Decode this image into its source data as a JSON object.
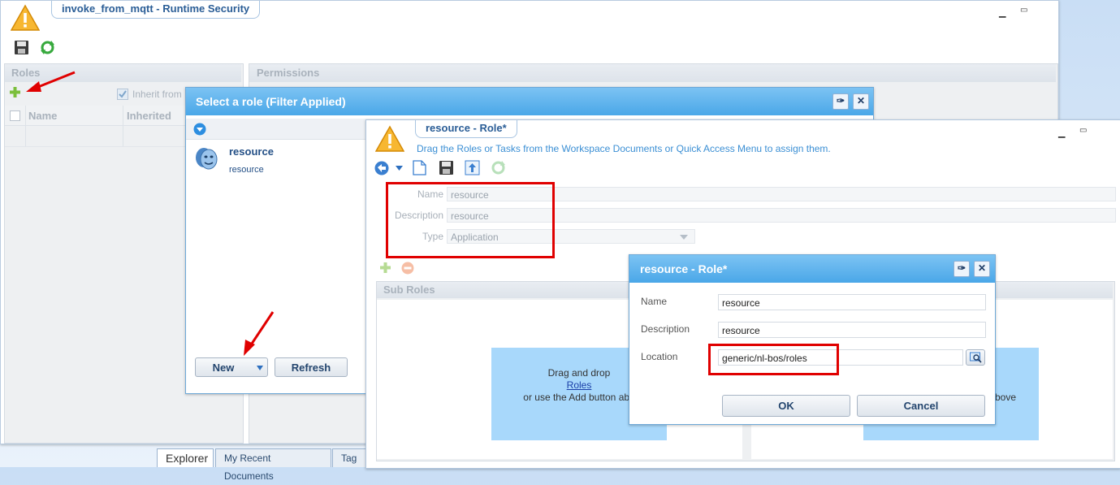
{
  "main_window": {
    "title": "invoke_from_mqtt - Runtime Security",
    "roles_panel": {
      "title": "Roles",
      "inherit_label": "Inherit from",
      "columns": [
        "Name",
        "Inherited"
      ]
    },
    "permissions_panel": {
      "title": "Permissions"
    }
  },
  "select_role_dialog": {
    "title": "Select a role (Filter Applied)",
    "item": {
      "name": "resource",
      "subtitle": "resource"
    },
    "new_label": "New",
    "refresh_label": "Refresh"
  },
  "role_editor": {
    "title": "resource - Role*",
    "instruction": "Drag the Roles or Tasks from the Workspace Documents or Quick Access Menu to assign them.",
    "name_label": "Name",
    "name_value": "resource",
    "description_label": "Description",
    "description_value": "resource",
    "type_label": "Type",
    "type_value": "Application",
    "sub_roles_title": "Sub Roles",
    "dropzone_left": {
      "line1": "Drag and drop",
      "link": "Roles",
      "line3": "or use the Add button abo"
    },
    "dropzone_right": {
      "line3": "bove"
    }
  },
  "role_dialog": {
    "title": "resource - Role*",
    "name_label": "Name",
    "name_value": "resource",
    "description_label": "Description",
    "description_value": "resource",
    "location_label": "Location",
    "location_value": "generic/nl-bos/roles",
    "ok_label": "OK",
    "cancel_label": "Cancel"
  },
  "bottom_tabs": [
    "Explorer",
    "My Recent Documents",
    "Tag S"
  ],
  "colors": {
    "accent": "#4aa7e8",
    "highlight": "#e00000",
    "dropzone": "#a8d8fb"
  }
}
